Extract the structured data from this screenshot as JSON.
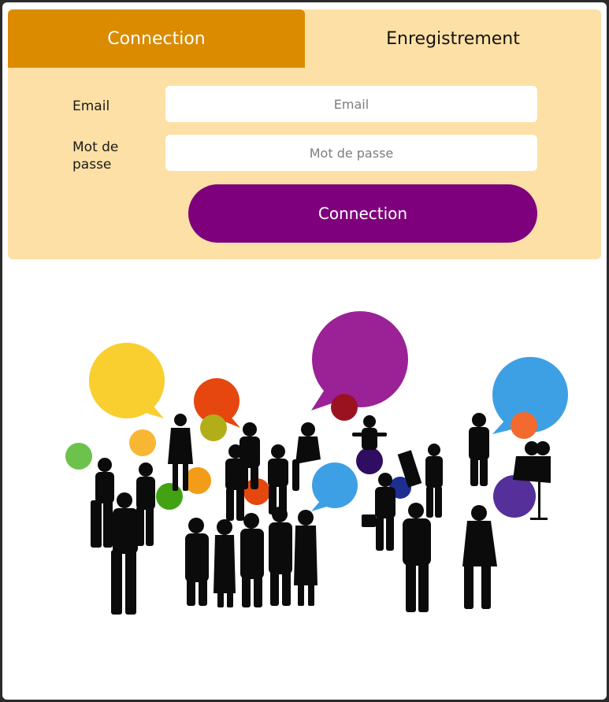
{
  "tabs": {
    "login_label": "Connection",
    "register_label": "Enregistrement"
  },
  "form": {
    "email_label": "Email",
    "email_placeholder": "Email",
    "password_label": "Mot de passe",
    "password_placeholder": "Mot de passe",
    "submit_label": "Connection"
  },
  "colors": {
    "active_tab": "#da8b00",
    "card_background": "#fde0a5",
    "submit_button": "#7f007d"
  },
  "illustration": {
    "subject": "people-silhouettes-with-speech-bubbles"
  }
}
